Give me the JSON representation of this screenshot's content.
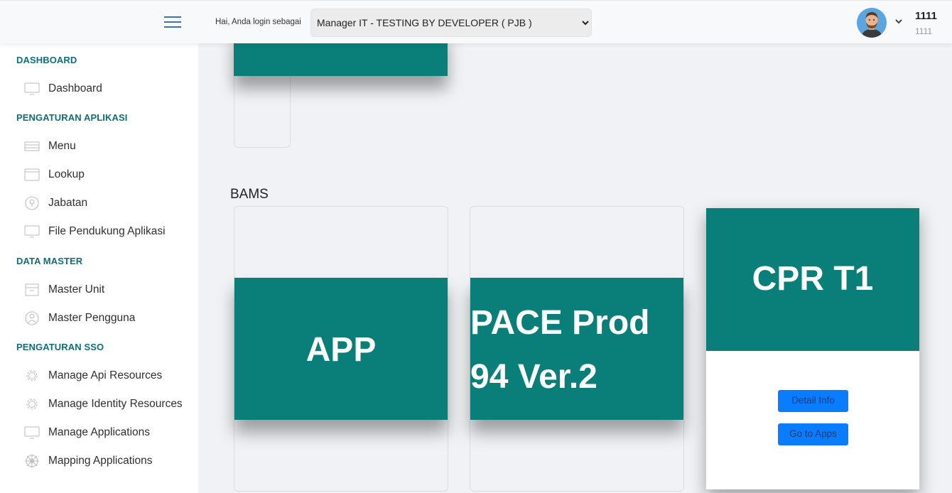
{
  "header": {
    "login_label": "Hai, Anda login sebagai",
    "role_selected": "Manager IT - TESTING BY DEVELOPER ( PJB )",
    "user_name": "1111",
    "user_sub": "1111"
  },
  "sidebar": {
    "sections": [
      {
        "title": "DASHBOARD",
        "items": [
          {
            "label": "Dashboard",
            "icon": "monitor-icon"
          }
        ]
      },
      {
        "title": "PENGATURAN APLIKASI",
        "items": [
          {
            "label": "Menu",
            "icon": "menu-lines-icon"
          },
          {
            "label": "Lookup",
            "icon": "folder-icon"
          },
          {
            "label": "Jabatan",
            "icon": "badge-icon"
          },
          {
            "label": "File Pendukung Aplikasi",
            "icon": "monitor-icon"
          }
        ]
      },
      {
        "title": "DATA MASTER",
        "items": [
          {
            "label": "Master Unit",
            "icon": "archive-icon"
          },
          {
            "label": "Master Pengguna",
            "icon": "user-icon"
          }
        ]
      },
      {
        "title": "PENGATURAN SSO",
        "items": [
          {
            "label": "Manage Api Resources",
            "icon": "gear-icon"
          },
          {
            "label": "Manage Identity Resources",
            "icon": "gear-icon"
          },
          {
            "label": "Manage Applications",
            "icon": "monitor-icon"
          },
          {
            "label": "Mapping Applications",
            "icon": "wheel-icon"
          }
        ]
      }
    ]
  },
  "main": {
    "section_label": "BAMS",
    "cards": [
      {
        "title": "APP"
      },
      {
        "title_line1": "PACE Prod",
        "title_line2": "94 Ver.2"
      },
      {
        "title": "CPR T1",
        "detail_button": "Detail Info",
        "apps_button": "Go to Apps"
      }
    ]
  },
  "colors": {
    "teal": "#0a7f7a",
    "accent": "#0a7cff",
    "section_title": "#0f6e7a"
  }
}
